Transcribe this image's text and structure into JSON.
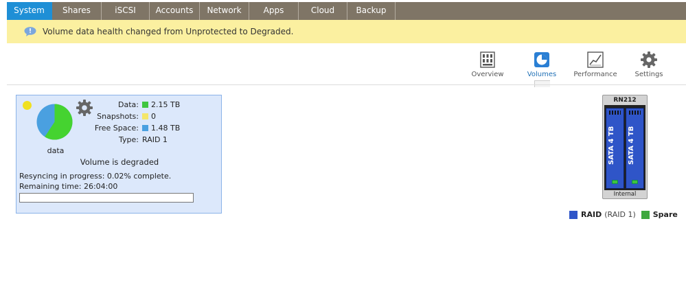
{
  "nav": {
    "tabs": [
      {
        "label": "System",
        "active": true
      },
      {
        "label": "Shares"
      },
      {
        "label": "iSCSI"
      },
      {
        "label": "Accounts"
      },
      {
        "label": "Network"
      },
      {
        "label": "Apps"
      },
      {
        "label": "Cloud"
      },
      {
        "label": "Backup"
      }
    ]
  },
  "alert": {
    "icon": "speech-bubble-icon",
    "message": "Volume data health changed from Unprotected to Degraded."
  },
  "subtabs": [
    {
      "label": "Overview",
      "icon": "grid-icon"
    },
    {
      "label": "Volumes",
      "icon": "volume-pie-icon",
      "active": true
    },
    {
      "label": "Performance",
      "icon": "line-graph-icon"
    },
    {
      "label": "Settings",
      "icon": "gear-icon"
    }
  ],
  "volume": {
    "name": "data",
    "status_color": "#f0e020",
    "stats": {
      "data_label": "Data:",
      "data_value": "2.15 TB",
      "data_color": "#3fc63f",
      "snapshots_label": "Snapshots:",
      "snapshots_value": "0",
      "snapshots_color": "#f4e66a",
      "free_label": "Free Space:",
      "free_value": "1.48 TB",
      "free_color": "#4aa0e0",
      "type_label": "Type:",
      "type_value": "RAID 1"
    },
    "usage": {
      "data_tb": 2.15,
      "free_tb": 1.48
    },
    "health": "Volume is degraded",
    "resync_text": "Resyncing in progress: 0.02% complete.",
    "remaining_text": "Remaining time: 26:04:00",
    "progress_fraction": 0.0002
  },
  "device": {
    "model": "RN212",
    "drives": [
      {
        "label": "SATA 4 TB"
      },
      {
        "label": "SATA 4 TB"
      }
    ],
    "caption": "Internal"
  },
  "legend": {
    "raid_label": "RAID",
    "raid_detail": "(RAID 1)",
    "raid_color": "#2f55c8",
    "spare_label": "Spare",
    "spare_color": "#3ea83e"
  }
}
